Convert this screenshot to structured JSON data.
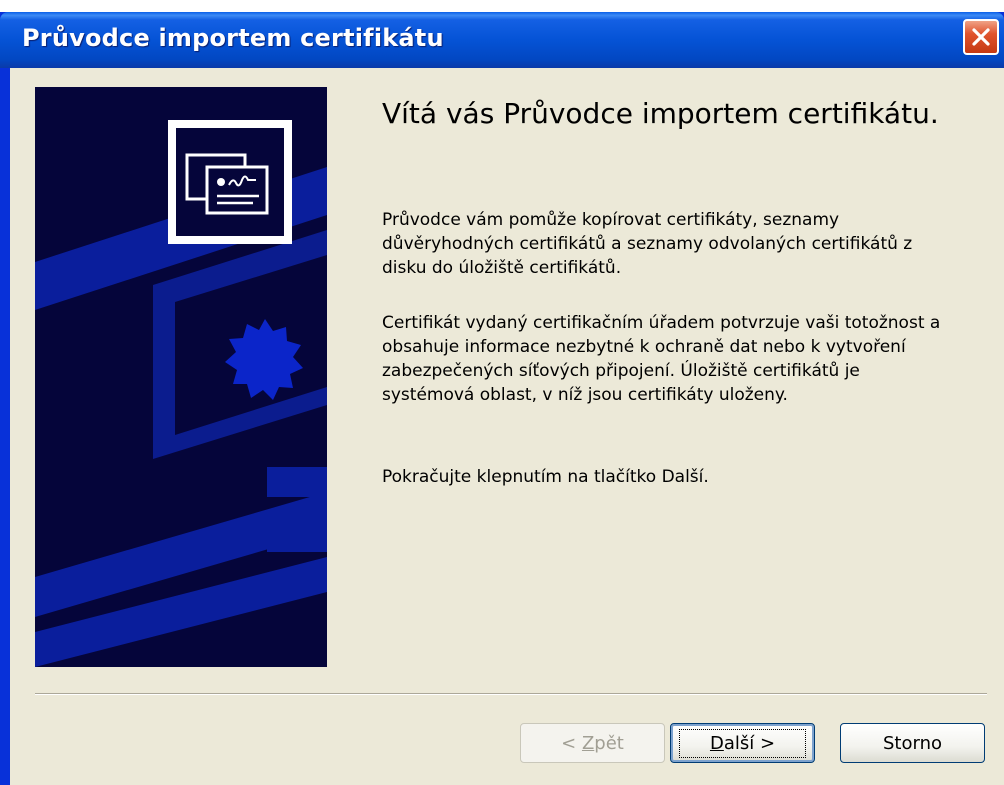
{
  "window": {
    "title": "Průvodce importem certifikátu",
    "close_icon": "close-icon"
  },
  "banner": {
    "icon": "certificate-icon",
    "colors": {
      "background": "#05053a",
      "stripes": "#0a1e9c"
    }
  },
  "content": {
    "heading": "Vítá vás Průvodce importem certifikátu.",
    "paragraph1": "Průvodce vám pomůže kopírovat certifikáty, seznamy důvěryhodných certifikátů a seznamy odvolaných certifikátů z disku do úložiště certifikátů.",
    "paragraph2": "Certifikát vydaný certifikačním úřadem potvrzuje vaši totožnost a obsahuje informace nezbytné k ochraně dat nebo k vytvoření zabezpečených síťových připojení. Úložiště certifikátů je systémová oblast, v níž jsou certifikáty uloženy.",
    "paragraph3": "Pokračujte klepnutím na tlačítko Další."
  },
  "buttons": {
    "back": {
      "prefix": "< ",
      "mnemonic": "Z",
      "rest": "pět",
      "disabled": true
    },
    "next": {
      "mnemonic": "D",
      "rest": "alší >"
    },
    "cancel": {
      "label": "Storno"
    }
  }
}
